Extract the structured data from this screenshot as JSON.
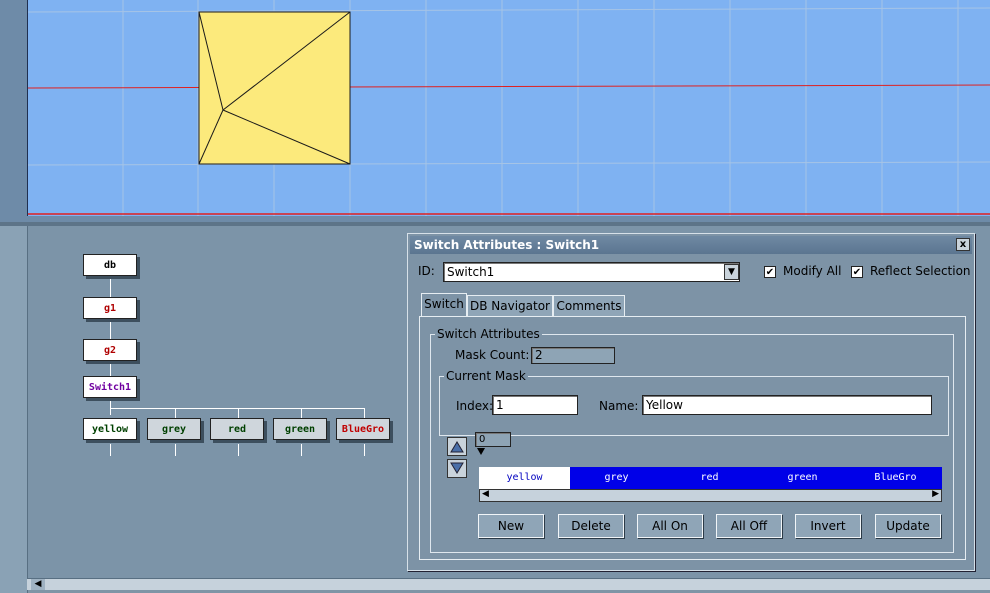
{
  "tree": {
    "nodes": [
      {
        "label": "db",
        "color": "#000000"
      },
      {
        "label": "g1",
        "color": "#b00000"
      },
      {
        "label": "g2",
        "color": "#b00000"
      },
      {
        "label": "Switch1",
        "color": "#7000a0"
      },
      {
        "label": "yellow",
        "color": "#004000"
      },
      {
        "label": "grey",
        "color": "#004000"
      },
      {
        "label": "red",
        "color": "#004000"
      },
      {
        "label": "green",
        "color": "#004000"
      },
      {
        "label": "BlueGro",
        "color": "#c00000"
      }
    ]
  },
  "dialog": {
    "title": "Switch Attributes : Switch1",
    "close_label": "x",
    "id_label": "ID:",
    "id_value": "Switch1",
    "modify_all_label": "Modify All",
    "modify_all_checked": true,
    "reflect_selection_label": "Reflect Selection",
    "reflect_selection_checked": true,
    "tabs": [
      {
        "label": "Switch",
        "active": true
      },
      {
        "label": "DB Navigator",
        "active": false
      },
      {
        "label": "Comments",
        "active": false
      }
    ],
    "switch_attributes_label": "Switch Attributes",
    "mask_count_label": "Mask Count:",
    "mask_count_value": "2",
    "current_mask_label": "Current Mask",
    "index_label": "Index:",
    "index_value": "1",
    "name_label": "Name:",
    "name_value": "Yellow",
    "mask_offset_value": "0",
    "masks": [
      {
        "label": "yellow",
        "on": false
      },
      {
        "label": "grey",
        "on": true
      },
      {
        "label": "red",
        "on": true
      },
      {
        "label": "green",
        "on": true
      },
      {
        "label": "BlueGro",
        "on": true
      }
    ],
    "buttons": {
      "new": "New",
      "delete": "Delete",
      "all_on": "All On",
      "all_off": "All Off",
      "invert": "Invert",
      "update": "Update"
    }
  },
  "colors": {
    "viewport_bg": "#7fb2f2",
    "face_fill": "#fcea7c",
    "grid_line": "#a6c4e6",
    "axis_line": "#e02020",
    "mask_on": "#0000e8",
    "mask_off": "#ffffff"
  }
}
